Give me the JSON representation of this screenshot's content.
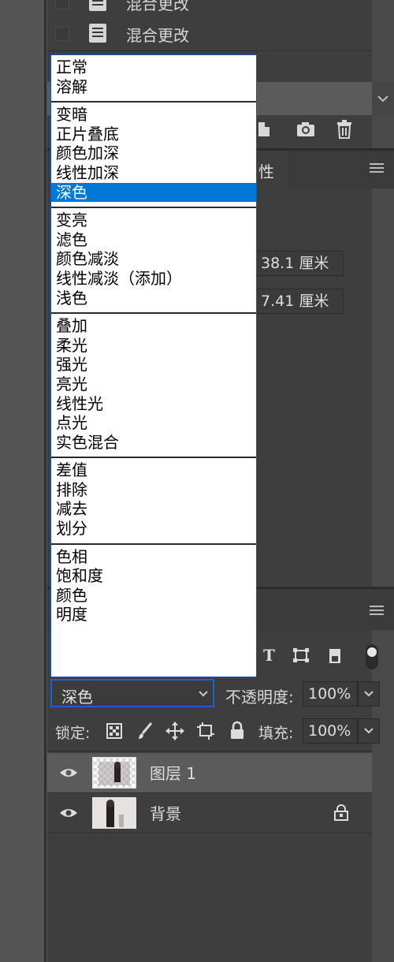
{
  "history": {
    "items": [
      {
        "label": "混合更改"
      },
      {
        "label": "混合更改"
      }
    ]
  },
  "blend_menu": {
    "groups": [
      [
        "正常",
        "溶解"
      ],
      [
        "变暗",
        "正片叠底",
        "颜色加深",
        "线性加深",
        "深色"
      ],
      [
        "变亮",
        "滤色",
        "颜色减淡",
        "线性减淡（添加）",
        "浅色"
      ],
      [
        "叠加",
        "柔光",
        "强光",
        "亮光",
        "线性光",
        "点光",
        "实色混合"
      ],
      [
        "差值",
        "排除",
        "减去",
        "划分"
      ],
      [
        "色相",
        "饱和度",
        "颜色",
        "明度"
      ]
    ],
    "selected": "深色"
  },
  "properties": {
    "tab_label": "性",
    "width_value": "38.1 厘米",
    "height_value": "7.41 厘米"
  },
  "layers": {
    "blend_mode": "深色",
    "opacity_label": "不透明度:",
    "opacity_value": "100%",
    "lock_label": "锁定:",
    "fill_label": "填充:",
    "fill_value": "100%",
    "items": [
      {
        "name": "图层 1"
      },
      {
        "name": "背景"
      }
    ]
  }
}
